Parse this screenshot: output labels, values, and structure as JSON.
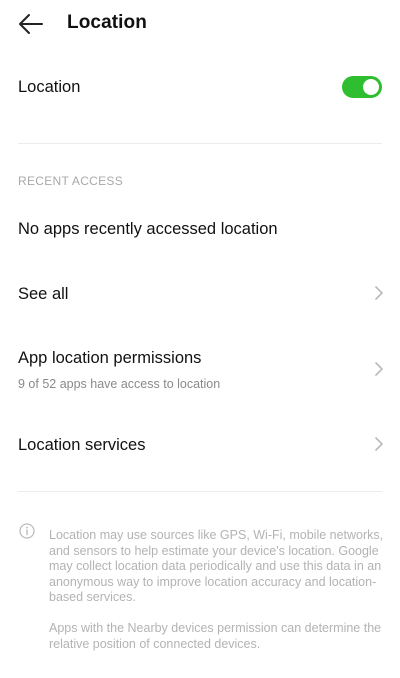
{
  "header": {
    "title": "Location",
    "back_icon": "arrow-left-icon"
  },
  "location_toggle": {
    "label": "Location",
    "state": "on",
    "on_color": "#2fbe2f"
  },
  "recent_access": {
    "section_title": "RECENT ACCESS",
    "empty_message": "No apps recently accessed location",
    "see_all_label": "See all"
  },
  "app_permissions": {
    "label": "App location permissions",
    "summary": "9 of 52 apps have access to location"
  },
  "location_services": {
    "label": "Location services"
  },
  "info": {
    "icon": "info-icon",
    "paragraph_1": "Location may use sources like GPS, Wi-Fi, mobile networks, and sensors to help estimate your device's location. Google may collect location data periodically and use this data in an anonymous way to improve location accuracy and location-based services.",
    "paragraph_2": "Apps with the Nearby devices permission can determine the relative position of connected devices."
  },
  "colors": {
    "accent_green": "#2fbe2f",
    "secondary_text": "#8a8a8a",
    "muted_text": "#b3b3b3"
  }
}
